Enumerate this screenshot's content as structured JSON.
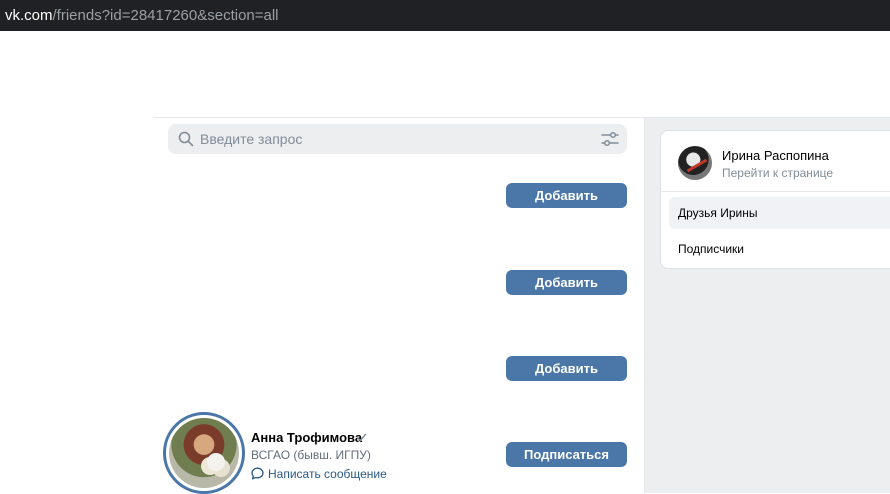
{
  "browser": {
    "url_host": "vk.com",
    "url_path": "/friends?id=28417260&section=all"
  },
  "search": {
    "placeholder": "Введите запрос"
  },
  "buttons": {
    "add_1": "Добавить",
    "add_2": "Добавить",
    "add_3": "Добавить",
    "subscribe": "Подписаться"
  },
  "friend": {
    "name": "Анна Трофимова",
    "subtitle": "ВСГАО (бывш. ИГПУ)",
    "message_link": "Написать сообщение"
  },
  "profile_card": {
    "name": "Ирина Распопина",
    "goto_link": "Перейти к странице",
    "menu": [
      "Друзья Ирины",
      "Подписчики"
    ]
  },
  "colors": {
    "accent": "#4a76a8",
    "link": "#2a5885",
    "muted": "#818c99",
    "panel_bg": "#edeef0"
  }
}
